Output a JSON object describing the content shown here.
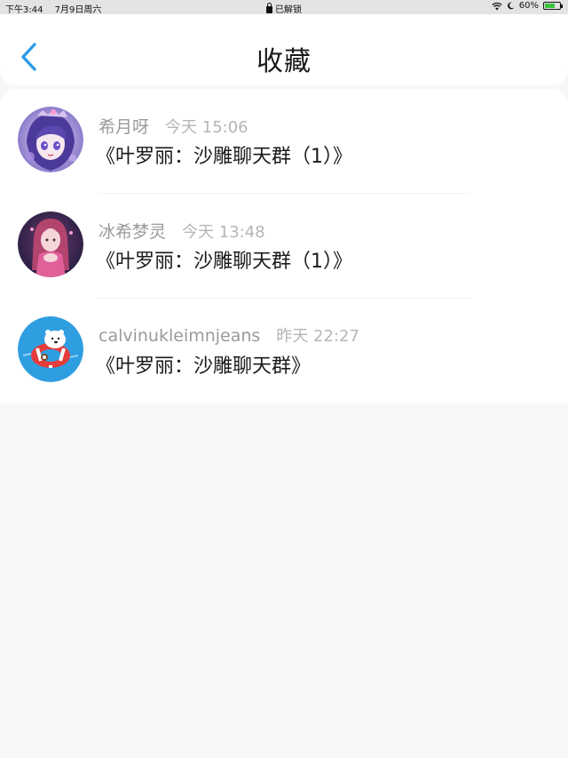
{
  "status_bar": {
    "time": "下午3:44",
    "date": "7月9日周六",
    "center_text": "已解锁",
    "battery": "60%",
    "battery_level": 0.6
  },
  "header": {
    "title": "收藏",
    "back_icon": "chevron-left-icon",
    "accent_color": "#2d9be8"
  },
  "favorites": [
    {
      "username": "希月呀",
      "timestamp": "今天 15:06",
      "title": "《叶罗丽：沙雕聊天群（1）》",
      "avatar": "anime-girl-purple"
    },
    {
      "username": "冰希梦灵",
      "timestamp": "今天 13:48",
      "title": "《叶罗丽：沙雕聊天群（1）》",
      "avatar": "anime-girl-pink"
    },
    {
      "username": "calvinukleimnjeans",
      "timestamp": "昨天 22:27",
      "title": "《叶罗丽：沙雕聊天群》",
      "avatar": "polar-bear-float"
    }
  ]
}
